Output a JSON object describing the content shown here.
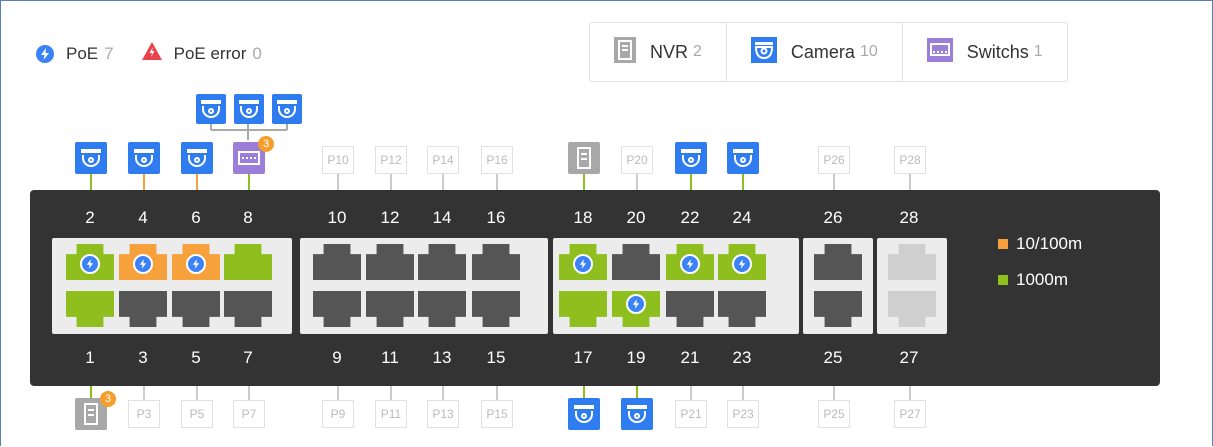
{
  "legend": {
    "poe": {
      "label": "PoE",
      "count": "7"
    },
    "poe_error": {
      "label": "PoE error",
      "count": "0"
    }
  },
  "filters": [
    {
      "label": "NVR",
      "count": "2",
      "icon": "nvr-icon"
    },
    {
      "label": "Camera",
      "count": "10",
      "icon": "camera-icon"
    },
    {
      "label": "Switchs",
      "count": "1",
      "icon": "switch-icon"
    }
  ],
  "colors": {
    "poe": "#3b82f6",
    "error": "#e8434b",
    "speed_100": "#f7a13c",
    "speed_1000": "#8fbe1f",
    "camera": "#2f7bf0",
    "nvr": "#a8a8a8",
    "switch": "#9a7ed8"
  },
  "switch": {
    "top_numbers": [
      "2",
      "4",
      "6",
      "8",
      "10",
      "12",
      "14",
      "16",
      "18",
      "20",
      "22",
      "24",
      "26",
      "28"
    ],
    "bottom_numbers": [
      "1",
      "3",
      "5",
      "7",
      "9",
      "11",
      "13",
      "15",
      "17",
      "19",
      "21",
      "23",
      "25",
      "27"
    ],
    "speed_legend": {
      "s100": "10/100m",
      "s1000": "1000m"
    }
  },
  "top_empty_ports": [
    "P10",
    "P12",
    "P14",
    "P16",
    "P20",
    "P26",
    "P28"
  ],
  "bottom_empty_ports": [
    "P3",
    "P5",
    "P7",
    "P9",
    "P11",
    "P13",
    "P15",
    "P21",
    "P23",
    "P25",
    "P27"
  ],
  "badges": {
    "switch_children": "3",
    "nvr_children": "3"
  }
}
